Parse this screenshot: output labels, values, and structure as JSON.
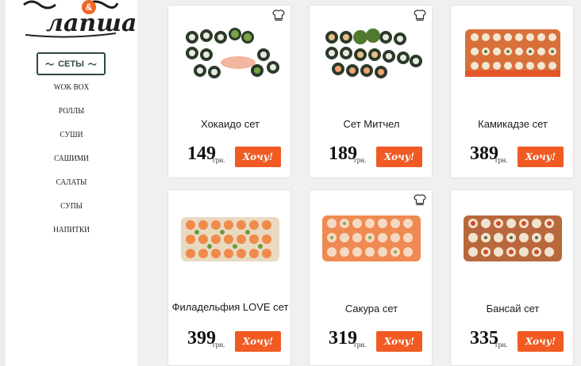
{
  "brand": {
    "logo_text": "лапша",
    "logo_amp": "&"
  },
  "menu": {
    "active": "СЕТЫ",
    "items": [
      "WOK BOX",
      "РОЛЛЫ",
      "СУШИ",
      "САШИМИ",
      "САЛАТЫ",
      "СУПЫ",
      "НАПИТКИ"
    ]
  },
  "products": [
    {
      "name": "Хокаидо сет",
      "price": "149",
      "currency": "грн.",
      "button": "Хочу!",
      "chef_badge": true
    },
    {
      "name": "Сет Митчел",
      "price": "189",
      "currency": "грн.",
      "button": "Хочу!",
      "chef_badge": true
    },
    {
      "name": "Камикадзе сет",
      "price": "389",
      "currency": "грн.",
      "button": "Хочу!",
      "chef_badge": false
    },
    {
      "name": "Филадельфия LOVE сет",
      "price": "399",
      "currency": "грн.",
      "button": "Хочу!",
      "chef_badge": false
    },
    {
      "name": "Сакура сет",
      "price": "319",
      "currency": "грн.",
      "button": "Хочу!",
      "chef_badge": true
    },
    {
      "name": "Бансай сет",
      "price": "335",
      "currency": "грн.",
      "button": "Хочу!",
      "chef_badge": false
    }
  ],
  "colors": {
    "accent": "#f15a22",
    "menu_border": "#2d4a39",
    "background": "#f0f0f0"
  }
}
